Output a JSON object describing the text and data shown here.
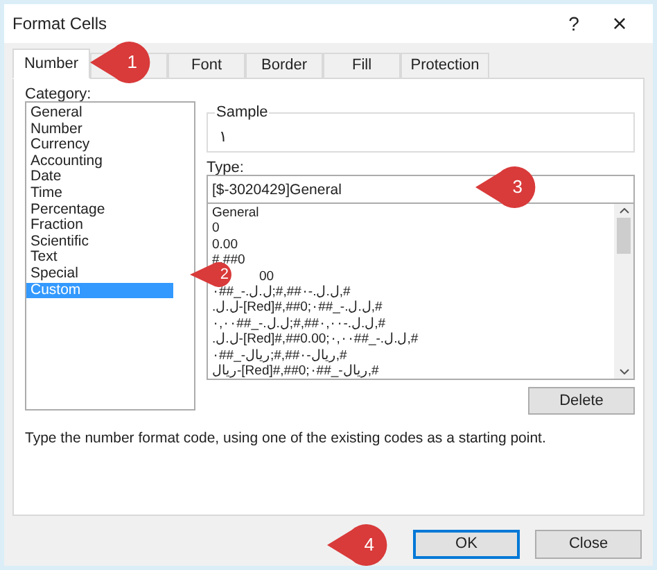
{
  "window": {
    "title": "Format Cells",
    "help": "?",
    "close": "×"
  },
  "tabs": [
    {
      "label": "Number",
      "selected": true
    },
    {
      "selected": false
    },
    {
      "label": "Font",
      "selected": false
    },
    {
      "label": "Border",
      "selected": false
    },
    {
      "label": "Fill",
      "selected": false
    },
    {
      "label": "Protection",
      "selected": false
    }
  ],
  "category": {
    "label": "Category:",
    "items": [
      {
        "label": "General",
        "selected": false
      },
      {
        "label": "Number",
        "selected": false
      },
      {
        "label": "Currency",
        "selected": false
      },
      {
        "label": "Accounting",
        "selected": false
      },
      {
        "label": "Date",
        "selected": false
      },
      {
        "label": "Time",
        "selected": false
      },
      {
        "label": "Percentage",
        "selected": false
      },
      {
        "label": "Fraction",
        "selected": false
      },
      {
        "label": "Scientific",
        "selected": false
      },
      {
        "label": "Text",
        "selected": false
      },
      {
        "label": "Special",
        "selected": false
      },
      {
        "label": "Custom",
        "selected": true
      }
    ]
  },
  "sample": {
    "label": "Sample",
    "value": "١"
  },
  "type": {
    "label": "Type:",
    "value": "[$-3020429]General",
    "items": [
      "General",
      "0",
      "0.00",
      "#,##0",
      {
        "text": "00",
        "kind": "covered"
      },
      "ل.ل.‏-٠##,#;ل.ل.‏-_##٠,#",
      "ل.ل.‏-[Red]#,##0;ل.ل.‏-_##٠,#",
      "ل.ل.‏-٠,٠٠##,#;ل.ل.‏-_##٠,٠٠,#",
      "ل.ل.‏-[Red]#,##0.00;ل.ل.‏-_##٠,٠٠,#",
      "ريال-٠##,#;ريال-_##٠,#",
      "ريال-[Red]#,##0;ريال-_##٠,#"
    ]
  },
  "delete_button": "Delete",
  "description": "Type the number format code, using one of the existing codes as a starting point.",
  "buttons": [
    {
      "label": "OK",
      "default": true
    },
    {
      "label": "Close",
      "default": false
    }
  ],
  "callouts": [
    "1",
    "2",
    "3",
    "4"
  ]
}
